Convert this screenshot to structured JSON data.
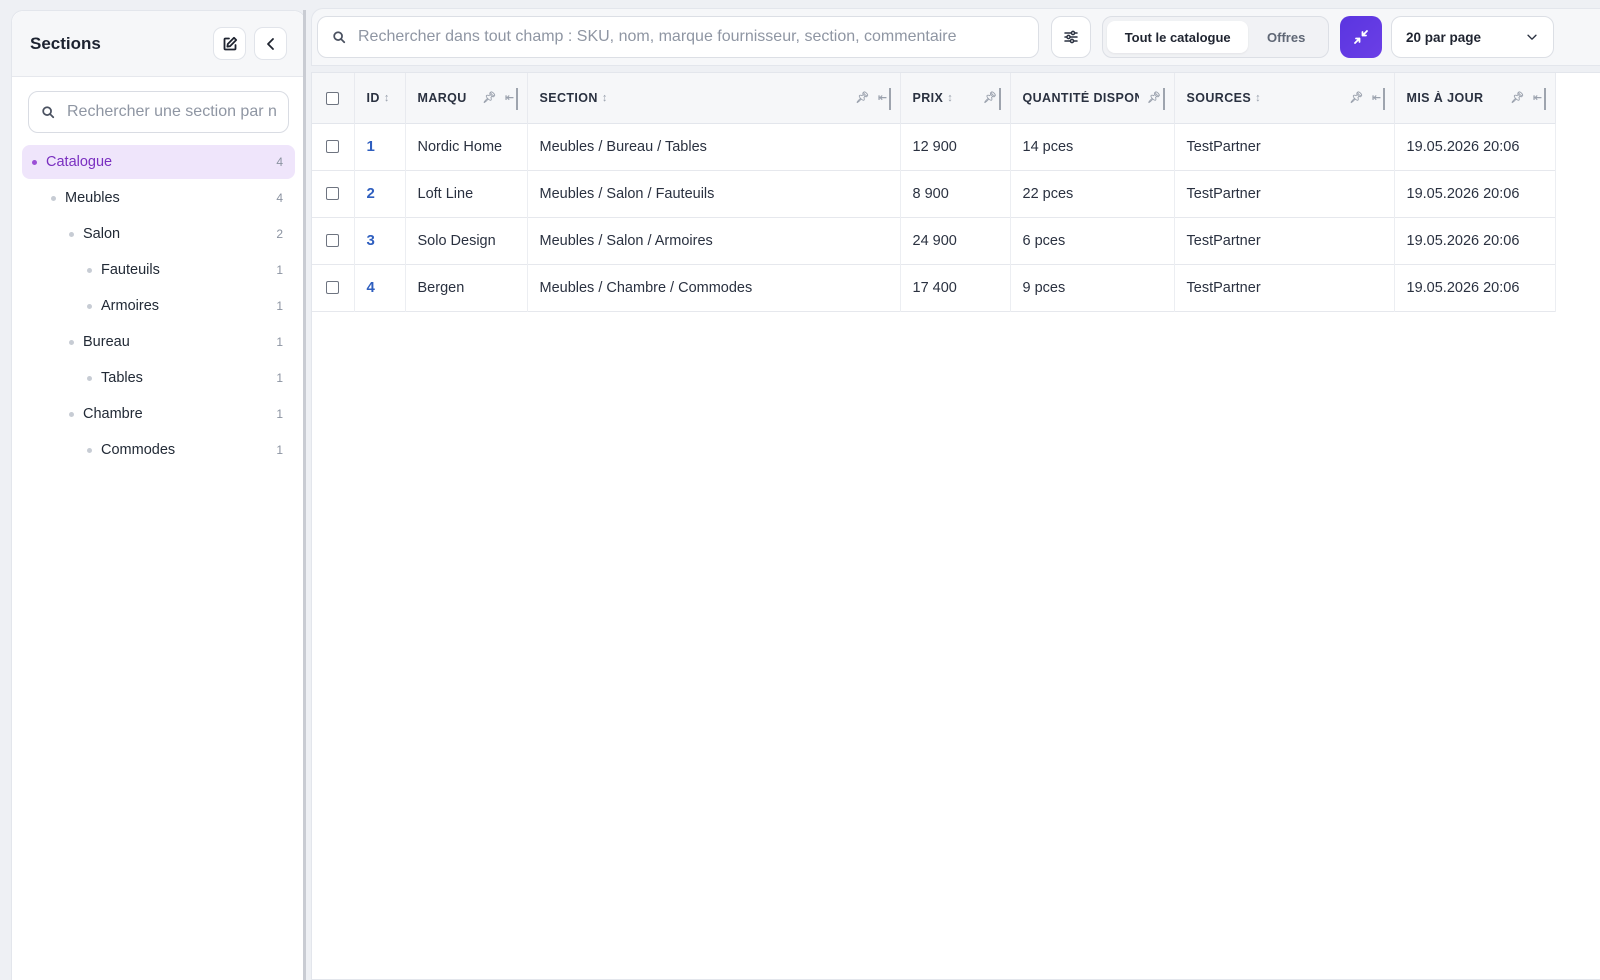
{
  "sidebar": {
    "title": "Sections",
    "search_placeholder": "Rechercher une section par nom",
    "items": [
      {
        "label": "Catalogue",
        "count": "4"
      },
      {
        "label": "Meubles",
        "count": "4"
      },
      {
        "label": "Salon",
        "count": "2"
      },
      {
        "label": "Fauteuils",
        "count": "1"
      },
      {
        "label": "Armoires",
        "count": "1"
      },
      {
        "label": "Bureau",
        "count": "1"
      },
      {
        "label": "Tables",
        "count": "1"
      },
      {
        "label": "Chambre",
        "count": "1"
      },
      {
        "label": "Commodes",
        "count": "1"
      }
    ]
  },
  "toolbar": {
    "search_placeholder": "Rechercher dans tout champ : SKU, nom, marque fournisseur, section, commentaire",
    "tab_all": "Tout le catalogue",
    "tab_offers": "Offres",
    "per_page": "20 par page"
  },
  "table": {
    "columns": [
      "ID",
      "MARQU",
      "SECTION",
      "PRIX",
      "QUANTITÉ DISPONIBLE",
      "SOURCES",
      "MIS À JOUR"
    ],
    "rows": [
      {
        "id": "1",
        "brand": "Nordic Home",
        "section": "Meubles / Bureau / Tables",
        "price": "12 900",
        "qty": "14 pces",
        "source": "TestPartner",
        "updated": "19.05.2026 20:06"
      },
      {
        "id": "2",
        "brand": "Loft Line",
        "section": "Meubles / Salon / Fauteuils",
        "price": "8 900",
        "qty": "22 pces",
        "source": "TestPartner",
        "updated": "19.05.2026 20:06"
      },
      {
        "id": "3",
        "brand": "Solo Design",
        "section": "Meubles / Salon / Armoires",
        "price": "24 900",
        "qty": "6 pces",
        "source": "TestPartner",
        "updated": "19.05.2026 20:06"
      },
      {
        "id": "4",
        "brand": "Bergen",
        "section": "Meubles / Chambre / Commodes",
        "price": "17 400",
        "qty": "9 pces",
        "source": "TestPartner",
        "updated": "19.05.2026 20:06"
      }
    ]
  },
  "colors": {
    "accent": "#6b3fe6",
    "active_bg": "#efe5fb",
    "active_text": "#7a2fc0",
    "link": "#2f5fbf"
  }
}
